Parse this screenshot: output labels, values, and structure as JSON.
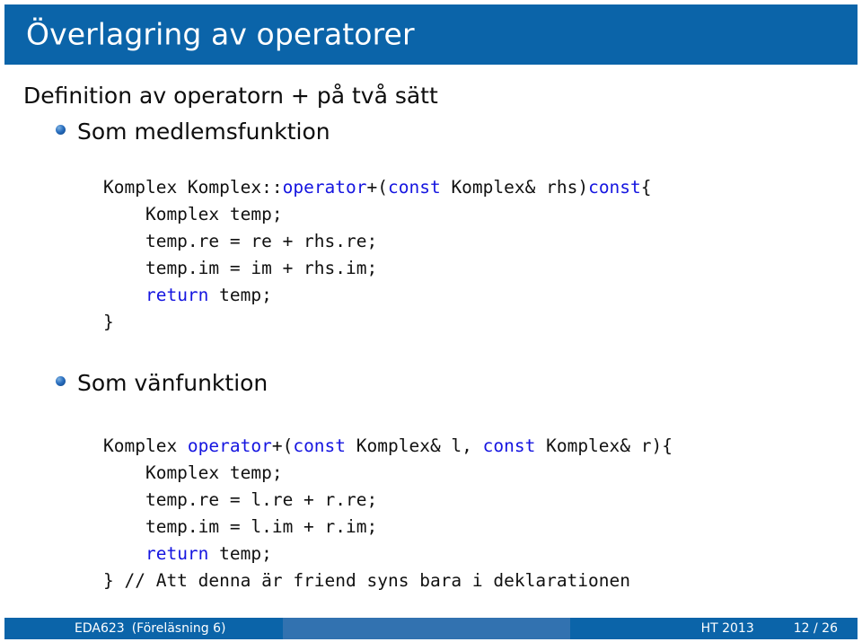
{
  "slide": {
    "title": "Överlagring av operatorer",
    "heading": "Definition av operatorn + på två sätt",
    "bullets": [
      {
        "label": "Som medlemsfunktion"
      },
      {
        "label": "Som vänfunktion"
      }
    ],
    "code_blocks": [
      {
        "id": "member-function-code",
        "lines": [
          "Komplex Komplex::operator+(const Komplex& rhs)const{",
          "    Komplex temp;",
          "    temp.re = re + rhs.re;",
          "    temp.im = im + rhs.im;",
          "    return temp;",
          "}"
        ],
        "text": "Komplex Komplex::operator+(const Komplex& rhs)const{\n    Komplex temp;\n    temp.re = re + rhs.re;\n    temp.im = im + rhs.im;\n    return temp;\n}",
        "keywords": [
          "operator",
          "const",
          "const",
          "return"
        ]
      },
      {
        "id": "friend-function-code",
        "lines": [
          "Komplex operator+(const Komplex& l, const Komplex& r){",
          "    Komplex temp;",
          "    temp.re = l.re + r.re;",
          "    temp.im = l.im + r.im;",
          "    return temp;",
          "} // Att denna är friend syns bara i deklarationen"
        ],
        "text": "Komplex operator+(const Komplex& l, const Komplex& r){\n    Komplex temp;\n    temp.re = l.re + r.re;\n    temp.im = l.im + r.im;\n    return temp;\n} // Att denna är friend syns bara i deklarationen",
        "keywords": [
          "operator",
          "const",
          "const",
          "return"
        ]
      }
    ]
  },
  "footer": {
    "institution": "EDA623",
    "lecture": "(Föreläsning 6)",
    "term": "HT 2013",
    "page": "12 / 26"
  },
  "colors": {
    "accent_dark": "#0b64a9",
    "accent_light": "#3272b0",
    "keyword": "#1515e0",
    "text": "#111111",
    "title_text": "#ffffff"
  }
}
